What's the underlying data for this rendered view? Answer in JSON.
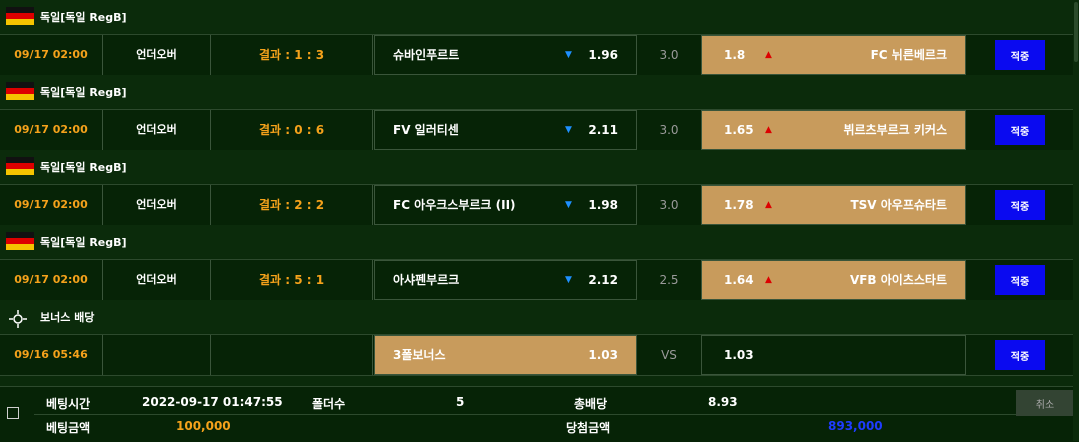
{
  "games": [
    {
      "league": "독일[독일 RegB]",
      "time": "09/17 02:00",
      "type": "언더오버",
      "result": "결과 : 1 : 3",
      "home_team": "슈바인푸르트",
      "home_odds": "1.96",
      "line": "3.0",
      "away_odds": "1.8",
      "away_team": "FC 뉘른베르크",
      "selected": "away",
      "apply_label": "적중"
    },
    {
      "league": "독일[독일 RegB]",
      "time": "09/17 02:00",
      "type": "언더오버",
      "result": "결과 : 0 : 6",
      "home_team": "FV 일러티센",
      "home_odds": "2.11",
      "line": "3.0",
      "away_odds": "1.65",
      "away_team": "뷔르츠부르크 키커스",
      "selected": "away",
      "apply_label": "적중"
    },
    {
      "league": "독일[독일 RegB]",
      "time": "09/17 02:00",
      "type": "언더오버",
      "result": "결과 : 2 : 2",
      "home_team": "FC 아우크스부르크 (II)",
      "home_odds": "1.98",
      "line": "3.0",
      "away_odds": "1.78",
      "away_team": "TSV 아우프슈타트",
      "selected": "away",
      "apply_label": "적중"
    },
    {
      "league": "독일[독일 RegB]",
      "time": "09/17 02:00",
      "type": "언더오버",
      "result": "결과 : 5 : 1",
      "home_team": "아샤펜부르크",
      "home_odds": "2.12",
      "line": "2.5",
      "away_odds": "1.64",
      "away_team": "VFB 아이츠스타트",
      "selected": "away",
      "apply_label": "적중"
    }
  ],
  "bonus": {
    "league": "보너스 배당",
    "icon": "bonus-target-icon",
    "time": "09/16 05:46",
    "home_team": "3폴보너스",
    "home_odds": "1.03",
    "line": "VS",
    "away_odds": "1.03",
    "apply_label": "적중"
  },
  "footer": {
    "bet_time_label": "베팅시간",
    "bet_time": "2022-09-17 01:47:55",
    "folders_label": "폴더수",
    "folders": "5",
    "total_odds_label": "총배당",
    "total_odds": "8.93",
    "bet_amount_label": "베팅금액",
    "bet_amount": "100,000",
    "win_amount_label": "당첨금액",
    "win_amount": "893,000",
    "cancel_label": "취소"
  },
  "colors": {
    "background": "#062306",
    "selected_cell": "#c89b5c",
    "accent_orange": "#f5a21b",
    "button_blue": "#0a0af0",
    "arrow_up_red": "#dd0000",
    "arrow_down_blue": "#1e90ff"
  }
}
